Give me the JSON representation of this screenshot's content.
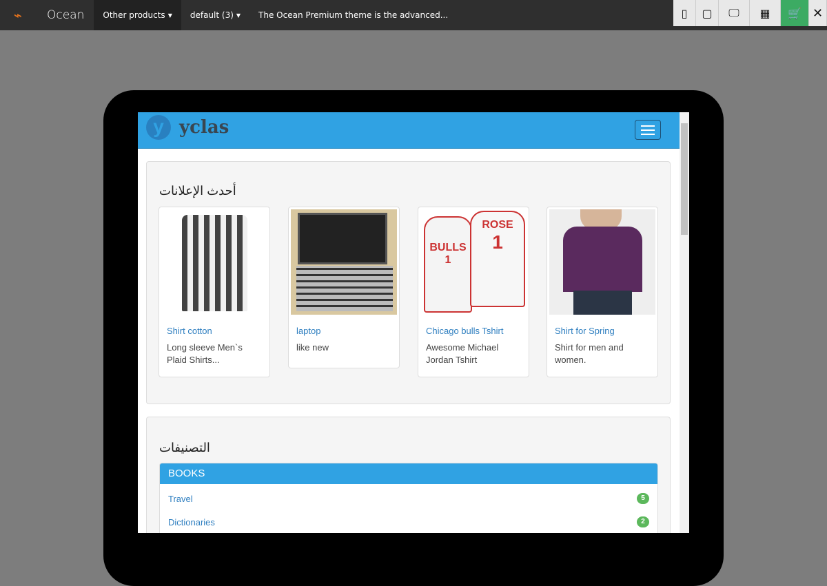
{
  "topbar": {
    "logo": "cart-logo",
    "brand": "Ocean",
    "other_products": "Other products",
    "default": "default (3)",
    "description": "The Ocean Premium theme is the advanced..."
  },
  "tools": [
    "mobile-icon",
    "tablet-icon",
    "desktop-icon",
    "qr-code-icon",
    "cart-icon",
    "close-icon"
  ],
  "site": {
    "logo_text": "yclas",
    "latest_heading": "أحدث الإعلانات",
    "categories_heading": "التصنيفات",
    "ads": [
      {
        "title": "Shirt cotton",
        "desc": "Long sleeve Men`s Plaid Shirts..."
      },
      {
        "title": "laptop",
        "desc": "like new"
      },
      {
        "title": "Chicago bulls Tshirt",
        "desc": "Awesome Michael Jordan Tshirt"
      },
      {
        "title": "Shirt for Spring",
        "desc": "Shirt for men and women."
      }
    ],
    "category": "BOOKS",
    "subcats": [
      {
        "name": "Travel",
        "count": "5"
      },
      {
        "name": "Dictionaries",
        "count": "2"
      }
    ]
  },
  "colors": {
    "accent": "#30a2e3",
    "badge": "#5cb85c",
    "cart": "#3cab63"
  }
}
